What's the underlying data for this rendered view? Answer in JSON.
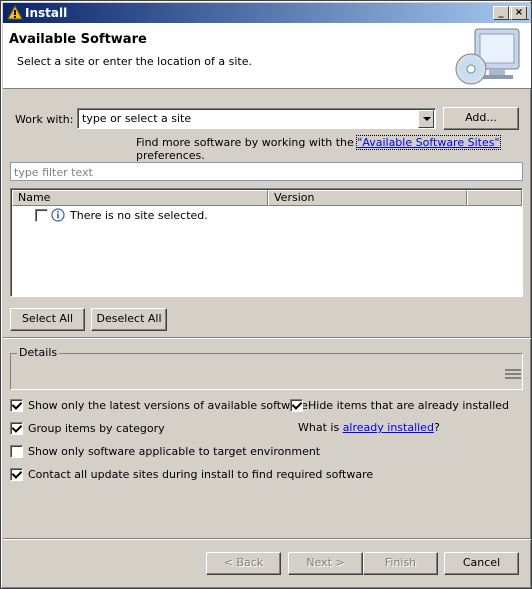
{
  "window": {
    "title": "Install",
    "controls": {
      "minimize": "_",
      "maximize": "□",
      "close": "×"
    }
  },
  "banner": {
    "heading": "Available Software",
    "description": "Select a site or enter the location of a site."
  },
  "work_with": {
    "label": "Work with:",
    "value": "type or select a site",
    "add_button": "Add..."
  },
  "find_more": {
    "prefix": "Find more software by working with the ",
    "link": "\"Available Software Sites\"",
    "suffix": " preferences."
  },
  "filter": {
    "placeholder": "type filter text"
  },
  "tree": {
    "columns": [
      "Name",
      "Version"
    ],
    "rows": [
      {
        "checked": false,
        "text": "There is no site selected.",
        "icon": "info-icon"
      }
    ]
  },
  "selection_buttons": {
    "select_all": "Select All",
    "deselect_all": "Deselect All"
  },
  "details": {
    "title": "Details"
  },
  "options": {
    "latest_versions": {
      "label": "Show only the latest versions of available software",
      "checked": true
    },
    "hide_installed": {
      "label": "Hide items that are already installed",
      "checked": true
    },
    "group_by_category": {
      "label": "Group items by category",
      "checked": true
    },
    "what_is_prefix": "What is ",
    "already_installed_link": "already installed",
    "what_is_suffix": "?",
    "target_env": {
      "label": "Show only software applicable to target environment",
      "checked": false
    },
    "contact_sites": {
      "label": "Contact all update sites during install to find required software",
      "checked": true
    }
  },
  "footer": {
    "back": "< Back",
    "next": "Next >",
    "finish": "Finish",
    "cancel": "Cancel"
  },
  "colors": {
    "titlebar_start": "#0a246a",
    "titlebar_end": "#a6caf0",
    "dialog_bg": "#d4d0c8",
    "link": "#0000ff"
  }
}
